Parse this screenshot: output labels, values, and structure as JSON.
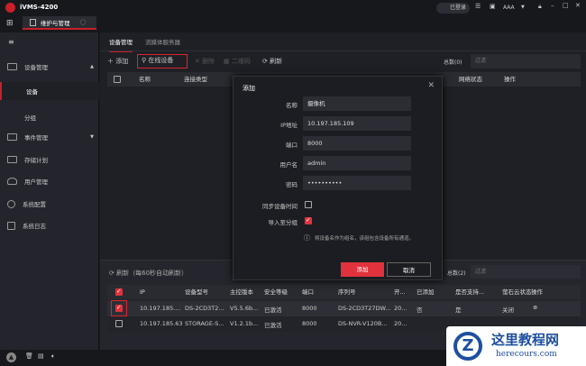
{
  "app": {
    "title": "iVMS-4200",
    "login": "已登录",
    "user": "AAA"
  },
  "tab": {
    "label": "维护与管理"
  },
  "sidebar": {
    "items": [
      {
        "label": "设备管理"
      },
      {
        "label": "设备"
      },
      {
        "label": "分组"
      },
      {
        "label": "事件管理"
      },
      {
        "label": "存储计划"
      },
      {
        "label": "用户管理"
      },
      {
        "label": "系统配置"
      },
      {
        "label": "系统日志"
      }
    ]
  },
  "main": {
    "tabs": [
      {
        "label": "设备管理"
      },
      {
        "label": "流媒体服务器"
      }
    ],
    "toolbar": {
      "add": "添加",
      "online": "在线设备",
      "delete": "删除",
      "qr": "二维码",
      "refresh": "刷新",
      "total": "总数(0)",
      "filter_placeholder": "过滤"
    },
    "columns": [
      "名称",
      "连接类型",
      "网络状态",
      "操作"
    ]
  },
  "online": {
    "refresh": "刷新（每60秒自动刷新）",
    "total": "总数(2)",
    "filter_placeholder": "过滤",
    "columns": [
      "IP",
      "设备型号",
      "主控版本",
      "安全等级",
      "端口",
      "序列号",
      "开...",
      "已添加",
      "是否支持...",
      "萤石云状态",
      "操作"
    ],
    "rows": [
      {
        "ip": "10.197.185....",
        "model": "DS-2CD3T2...",
        "version": "V5.5.6b...",
        "security": "已激活",
        "port": "8000",
        "serial": "DS-2CD3T27DW...",
        "start": "20...",
        "added": "否",
        "support": "是",
        "cloud": "关闭",
        "checked": true
      },
      {
        "ip": "10.197.185.63",
        "model": "STORAGE-S...",
        "version": "V1.2.1b...",
        "security": "已激活",
        "port": "8000",
        "serial": "DS-NVR-V120B...",
        "start": "20...",
        "added": "",
        "support": "",
        "cloud": "",
        "checked": false
      }
    ]
  },
  "dialog": {
    "title": "添加",
    "fields": [
      {
        "label": "名称",
        "value": "摄像机"
      },
      {
        "label": "IP地址",
        "value": "10.197.185.109"
      },
      {
        "label": "端口",
        "value": "8000"
      },
      {
        "label": "用户名",
        "value": "admin"
      },
      {
        "label": "密码",
        "value": "••••••••••"
      }
    ],
    "sync_time": "同步设备时间",
    "import_group": "导入至分组",
    "hint": "将设备名作为组名，该组包含设备所有通道。",
    "ok": "添加",
    "cancel": "取消"
  },
  "watermark": {
    "text": "这里教程网",
    "url": "herecours.com"
  }
}
